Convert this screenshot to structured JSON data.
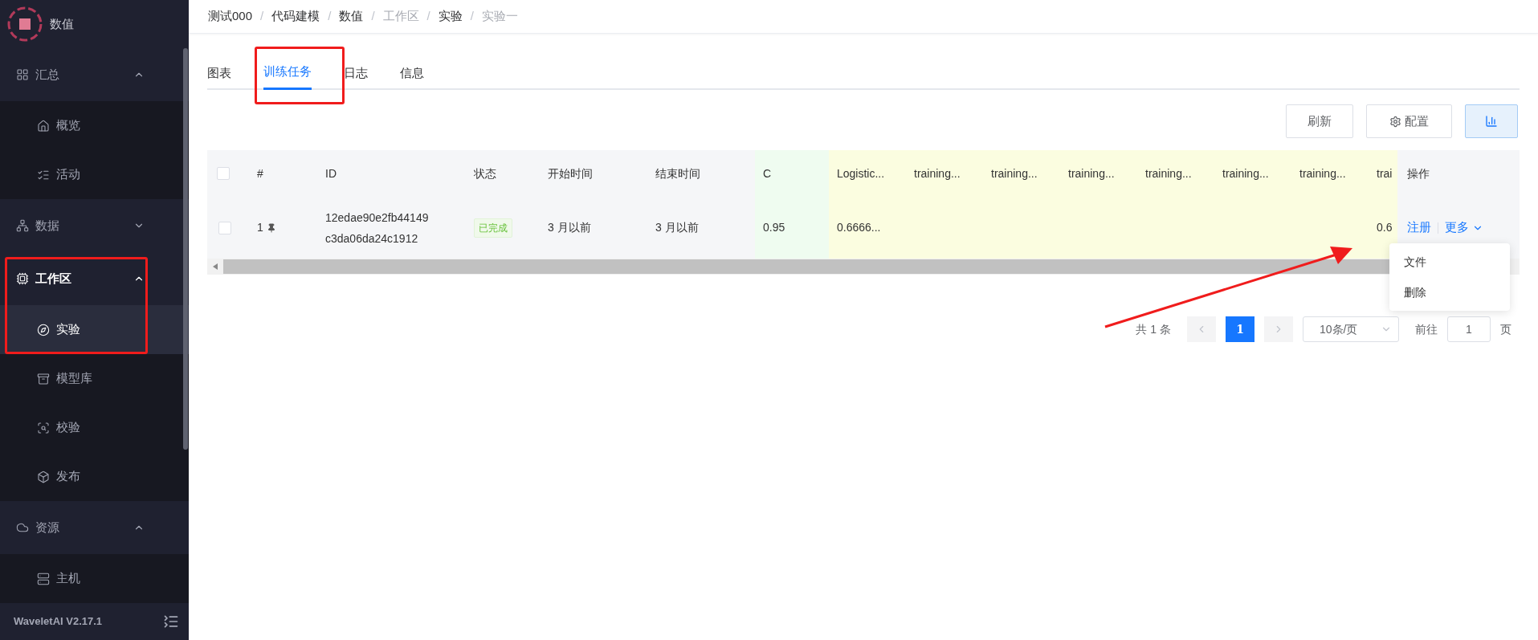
{
  "sidebar": {
    "logo_text": "数值",
    "version": "WaveletAI V2.17.1",
    "groups": [
      {
        "label": "汇总",
        "expanded": true,
        "active": false,
        "highlighted": false,
        "children": [
          {
            "label": "概览",
            "selected": false
          },
          {
            "label": "活动",
            "selected": false
          }
        ]
      },
      {
        "label": "数据",
        "expanded": false,
        "active": false,
        "highlighted": false
      },
      {
        "label": "工作区",
        "expanded": true,
        "active": true,
        "highlighted": true,
        "children": [
          {
            "label": "实验",
            "selected": true
          },
          {
            "label": "模型库",
            "selected": false
          },
          {
            "label": "校验",
            "selected": false
          },
          {
            "label": "发布",
            "selected": false
          }
        ]
      },
      {
        "label": "资源",
        "expanded": true,
        "active": false,
        "highlighted": false,
        "children": [
          {
            "label": "主机",
            "selected": false
          }
        ]
      }
    ]
  },
  "breadcrumb": {
    "separator": "/",
    "items": [
      {
        "label": "测试000",
        "link": true
      },
      {
        "label": "代码建模",
        "link": true
      },
      {
        "label": "数值",
        "link": true
      },
      {
        "label": "工作区",
        "link": false
      },
      {
        "label": "实验",
        "link": true
      },
      {
        "label": "实验一",
        "link": false
      }
    ]
  },
  "tabs": [
    {
      "label": "图表",
      "selected": false,
      "highlighted": false
    },
    {
      "label": "训练任务",
      "selected": true,
      "highlighted": true
    },
    {
      "label": "日志",
      "selected": false,
      "highlighted": false
    },
    {
      "label": "信息",
      "selected": false,
      "highlighted": false
    }
  ],
  "toolbar": [
    {
      "kind": "text",
      "label": "刷新",
      "selected": false
    },
    {
      "kind": "settings",
      "label": "配置",
      "selected": false
    },
    {
      "kind": "chart",
      "selected": true
    }
  ],
  "table": {
    "columns": [
      {
        "kind": "select",
        "checked": false
      },
      {
        "kind": "index",
        "label": "#"
      },
      {
        "kind": "id",
        "label": "ID"
      },
      {
        "kind": "status",
        "label": "状态"
      },
      {
        "kind": "plain",
        "label": "开始时间"
      },
      {
        "kind": "plain",
        "label": "结束时间"
      },
      {
        "kind": "param",
        "label": "C"
      },
      {
        "kind": "metric",
        "label": "Logistic..."
      },
      {
        "kind": "metric",
        "label": "training..."
      },
      {
        "kind": "metric",
        "label": "training..."
      },
      {
        "kind": "metric",
        "label": "training..."
      },
      {
        "kind": "metric",
        "label": "training..."
      },
      {
        "kind": "metric",
        "label": "training..."
      },
      {
        "kind": "metric",
        "label": "training..."
      },
      {
        "kind": "metric",
        "label": "trai"
      }
    ],
    "actions_header": "操作",
    "rows": [
      {
        "checked": false,
        "pinned": true,
        "completed": true,
        "cells": [
          "",
          "1",
          "12edae90e2fb44149c3da06da24c1912",
          "已完成",
          "3 月以前",
          "3 月以前",
          "0.95",
          "0.6666...",
          "",
          "",
          "",
          "",
          "",
          "",
          "0.6"
        ],
        "actions": [
          {
            "kind": "link",
            "label": "注册"
          },
          {
            "kind": "menu",
            "label": "更多",
            "expanded": true,
            "pointed": true,
            "menu": [
              "文件",
              "删除"
            ]
          }
        ]
      }
    ]
  },
  "pagination": {
    "total": "共 1 条",
    "prev": {
      "disabled": true
    },
    "pages": [
      {
        "label": "1",
        "selected": true
      }
    ],
    "next": {
      "disabled": true
    },
    "page_size": "10条/页",
    "goto_label": "前往",
    "goto_value": "1",
    "page_suffix": "页"
  }
}
